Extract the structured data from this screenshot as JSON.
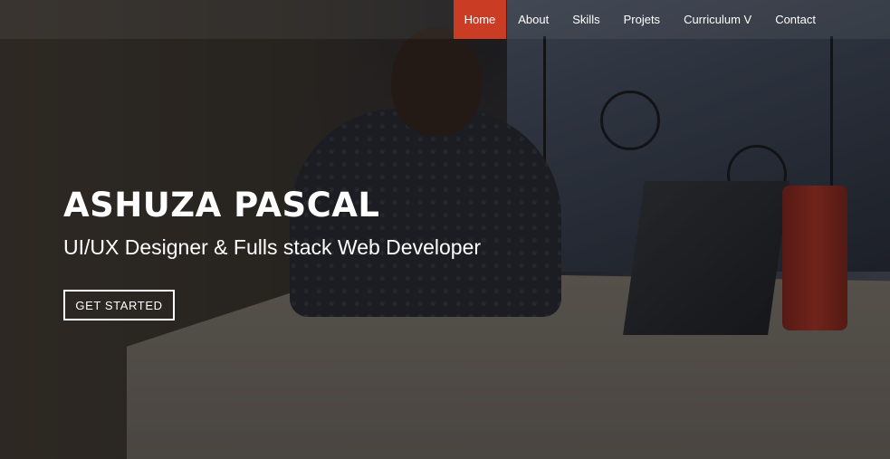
{
  "nav": {
    "items": [
      {
        "label": "Home",
        "active": true
      },
      {
        "label": "About"
      },
      {
        "label": "Skills"
      },
      {
        "label": "Projets"
      },
      {
        "label": "Curriculum V"
      },
      {
        "label": "Contact"
      }
    ]
  },
  "hero": {
    "name": "ASHUZA PASCAL",
    "subtitle": "UI/UX Designer & Fulls stack Web Developer",
    "cta_label": "GET STARTED"
  },
  "colors": {
    "accent": "#cb3c25",
    "text": "#ffffff"
  }
}
